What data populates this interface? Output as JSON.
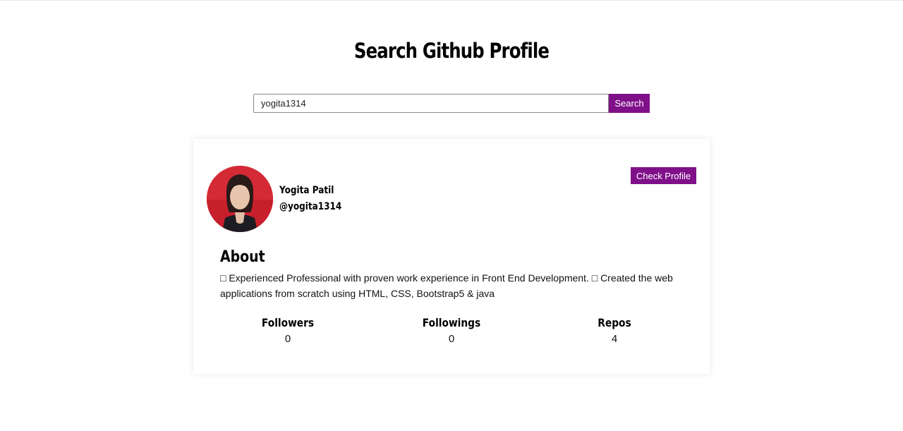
{
  "header": {
    "title": "Search Github Profile"
  },
  "search": {
    "value": "yogita1314",
    "button_label": "Search"
  },
  "profile": {
    "name": "Yogita Patil",
    "login": "@yogita1314",
    "check_profile_label": "Check Profile",
    "about_heading": "About",
    "bio": "□ Experienced Professional with proven work experience in Front End Development. □ Created the web applications from scratch using HTML, CSS, Bootstrap5 & java",
    "stats": [
      {
        "label": "Followers",
        "value": "0"
      },
      {
        "label": "Followings",
        "value": "0"
      },
      {
        "label": "Repos",
        "value": "4"
      }
    ]
  },
  "colors": {
    "accent": "#80108a",
    "avatar_background": "#d42a35"
  }
}
